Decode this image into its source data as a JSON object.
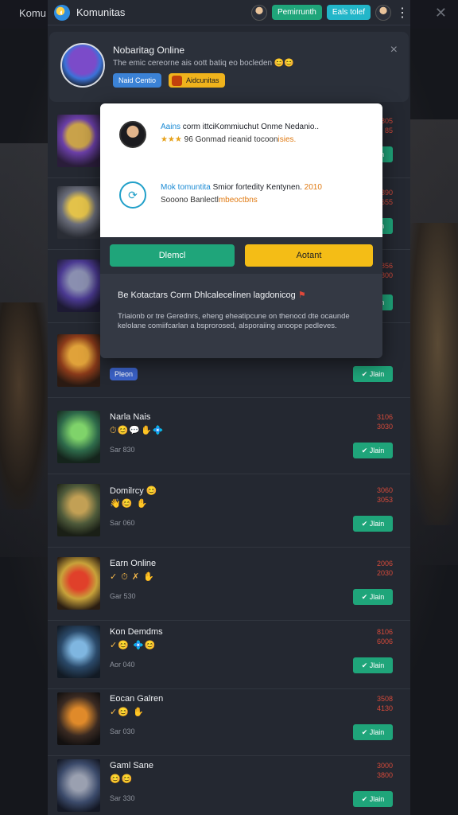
{
  "background_text": {
    "left": "Komu"
  },
  "app": {
    "title": "Komunitas",
    "logo_icon": "logo-icon",
    "btn_green": "Pemirrunth",
    "btn_teal": "Eals tolef",
    "menu": "⋮"
  },
  "profile": {
    "name": "Nobaritag Online",
    "subtitle": "The emic cereorne ais oott batiq eo bocleden 😊😊",
    "tag1": "Naid Centio",
    "tag2": "Aidcunitas",
    "close": "×"
  },
  "dialog": {
    "line1_hl": "Aains",
    "line1_rest": " corm  ittciKommiuchut Onme Nedanio..",
    "line2_stars": "★★★",
    "line2_mid": " 96 Gonmad rieanid tocoon",
    "line2_hl": "isies.",
    "line3_hl": "Mok tomuntita",
    "line3_rest": " Smior fortedity Kentynen.",
    "line3_year": "2010",
    "line4_a": "Sooono Banlectl",
    "line4_hl": "mbeoctbns",
    "btn_primary": "Dlemcl",
    "btn_secondary": "Aotant",
    "bottom_title": "Be Kotactars Corm Dhlcalecelinen lagdonicog",
    "bottom_flag": "⚑",
    "bottom_desc": "Triaionb or tre Gerednrs, eheng eheatipcune on thenocd dte ocaunde kelolane comiifcarlan a bsprorosed, alsporaiing anoope pedleves."
  },
  "rows": [
    {
      "name": "",
      "icons": "",
      "sub": "",
      "score1": "805",
      "score2": "85"
    },
    {
      "name": "",
      "icons": "",
      "sub": "",
      "score1": "890",
      "score2": "655"
    },
    {
      "name": "",
      "icons": "",
      "sub": "",
      "score1": "856",
      "score2": "800"
    },
    {
      "name": "",
      "icons": "",
      "sub": "",
      "score1": "",
      "score2": "",
      "chip": "Pleon"
    },
    {
      "name": "Narla Nais",
      "icons": "⏱😊💬✋💠",
      "sub": "Sar 830",
      "score1": "3106",
      "score2": "3030"
    },
    {
      "name": "Domilrcy 😊",
      "icons": "👋😊 ✋",
      "sub": "Sar 060",
      "score1": "3060",
      "score2": "3053"
    },
    {
      "name": "Earn Online",
      "icons": "✓ ⏱ ✗ ✋",
      "sub": "Gar 530",
      "score1": "2006",
      "score2": "2030"
    },
    {
      "name": "Kon Demdms",
      "icons": "✓😊 💠😊",
      "sub": "Aor 040",
      "score1": "8106",
      "score2": "6006"
    },
    {
      "name": "Eocan Galren",
      "icons": "✓😊 ✋",
      "sub": "Sar 030",
      "score1": "3508",
      "score2": "4130"
    },
    {
      "name": "Gaml Sane",
      "icons": "😊😊",
      "sub": "Sar 330",
      "score1": "3000",
      "score2": "3800"
    }
  ],
  "join_label": "✔ Jlain",
  "colors": {
    "accent_green": "#1fa57a",
    "accent_teal": "#22b6c9",
    "accent_yellow": "#f4bd16",
    "score_red": "#d64a3a"
  }
}
